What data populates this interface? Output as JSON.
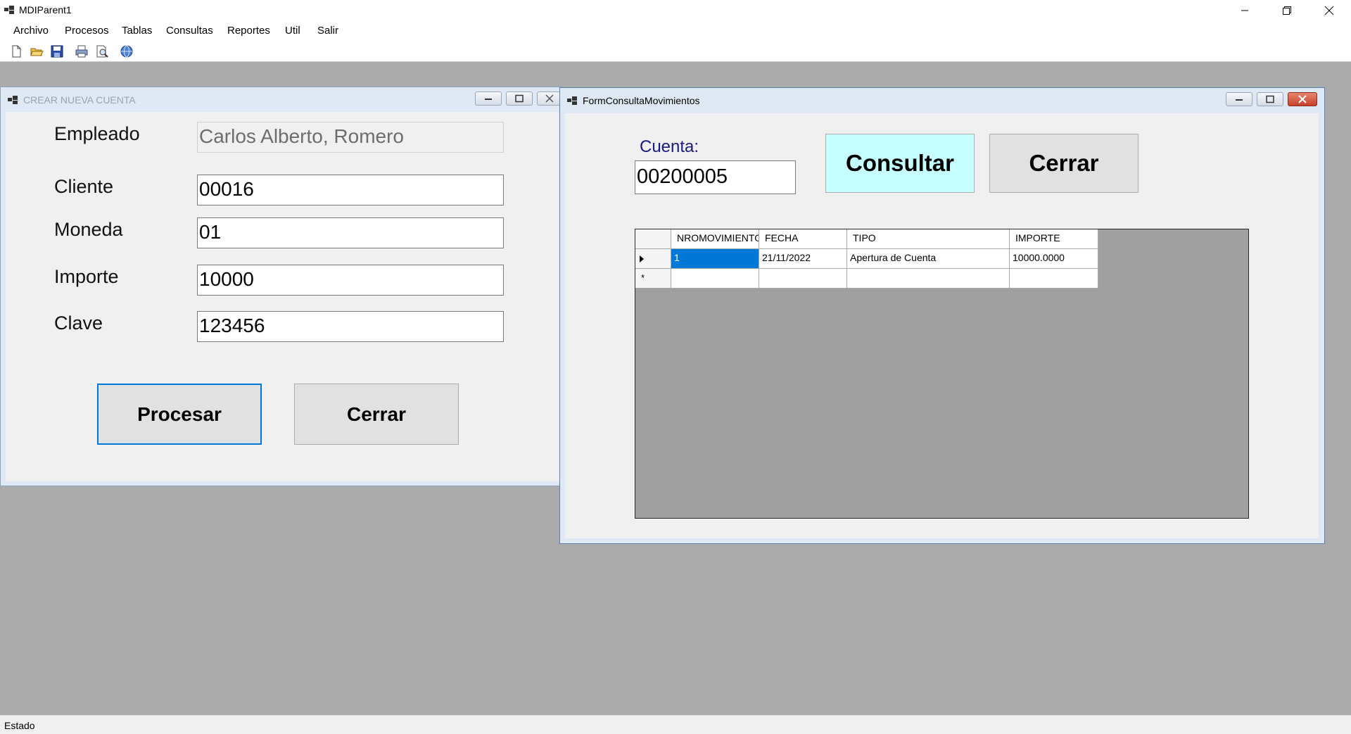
{
  "app": {
    "title": "MDIParent1"
  },
  "menu": [
    "Archivo",
    "Procesos",
    "Tablas",
    "Consultas",
    "Reportes",
    "Util",
    "Salir"
  ],
  "toolbar": [
    "new-icon",
    "open-folder-icon",
    "save-icon",
    "print-icon",
    "print-preview-icon",
    "help-globe-icon"
  ],
  "status": {
    "text": "Estado"
  },
  "crear_cuenta": {
    "title": "CREAR NUEVA CUENTA",
    "empleado_label": "Empleado",
    "empleado_value": "Carlos Alberto, Romero",
    "cliente_label": "Cliente",
    "cliente_value": "00016",
    "moneda_label": "Moneda",
    "moneda_value": "01",
    "importe_label": "Importe",
    "importe_value": "10000",
    "clave_label": "Clave",
    "clave_value": "123456",
    "procesar_label": "Procesar",
    "cerrar_label": "Cerrar"
  },
  "consulta": {
    "title": "FormConsultaMovimientos",
    "cuenta_label": "Cuenta:",
    "cuenta_value": "00200005",
    "consultar_label": "Consultar",
    "cerrar_label": "Cerrar",
    "columns": [
      "NROMOVIMIENTO",
      "FECHA",
      "TIPO",
      "IMPORTE"
    ],
    "rows": [
      [
        "1",
        "21/11/2022",
        "Apertura de Cuenta",
        "10000.0000"
      ]
    ],
    "new_row_marker": "*",
    "accent_selected": "#0078d7",
    "accent_consultar": "#c6ffff"
  }
}
